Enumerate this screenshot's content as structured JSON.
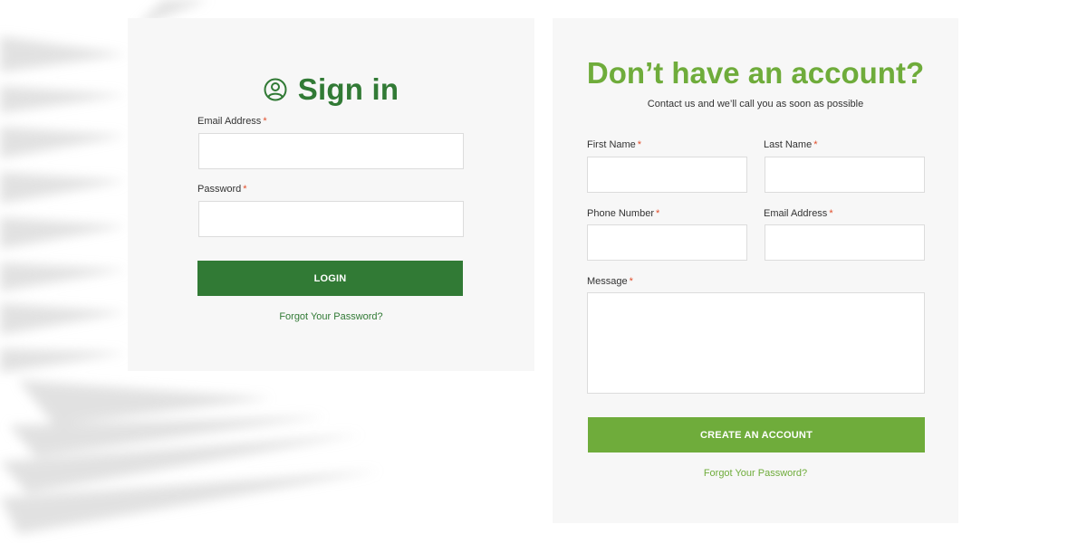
{
  "signin": {
    "title": "Sign in",
    "email_label": "Email Address",
    "password_label": "Password",
    "required_marker": "*",
    "login_button": "LOGIN",
    "forgot_link": "Forgot Your Password?"
  },
  "register": {
    "title": "Don’t have an account?",
    "subtitle": "Contact us and we’ll call you as soon as possible",
    "first_name_label": "First Name",
    "last_name_label": "Last Name",
    "phone_label": "Phone Number",
    "email_label": "Email Address",
    "message_label": "Message",
    "required_marker": "*",
    "create_button": "CREATE AN ACCOUNT",
    "forgot_link": "Forgot Your Password?"
  },
  "icons": {
    "signin": "user-circle-icon"
  },
  "colors": {
    "dark_green": "#317a35",
    "light_green": "#6fac3b",
    "required": "#e14d2a",
    "panel_bg": "#f7f7f7"
  }
}
